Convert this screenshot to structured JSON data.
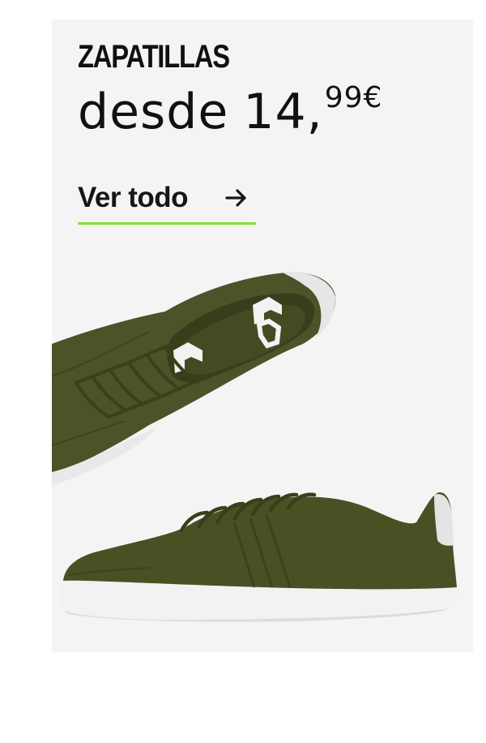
{
  "banner": {
    "title": "ZAPATILLAS",
    "price_prefix": "desde",
    "price_integer": "14,",
    "price_cents": "99€",
    "cta_label": "Ver todo",
    "cta_arrow_icon": "arrow-right-icon",
    "accent_color": "#84e12b",
    "background_color": "#f4f4f4",
    "product_color": "#4a4e24"
  }
}
